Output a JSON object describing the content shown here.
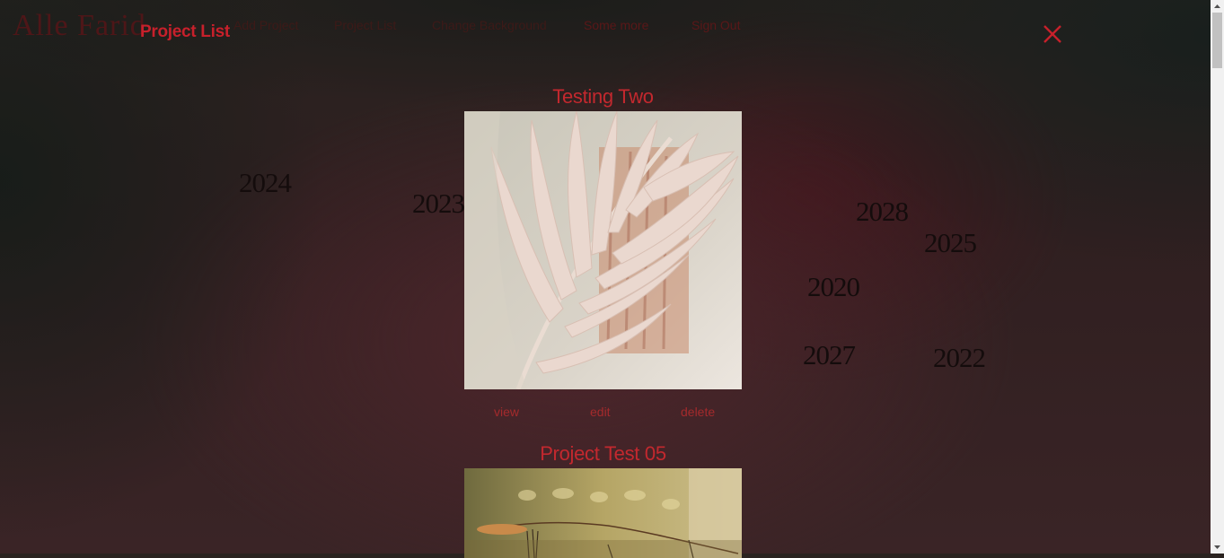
{
  "nav": {
    "logo": "Alle Farid",
    "active_label": "Project List",
    "links": [
      "Add Project",
      "Project List",
      "Change Background",
      "Some more",
      "Sign Out"
    ]
  },
  "years": [
    "2024",
    "2023",
    "2028",
    "2025",
    "2020",
    "2027",
    "2022"
  ],
  "projects": [
    {
      "title": "Testing Two",
      "actions": {
        "view": "view",
        "edit": "edit",
        "delete": "delete"
      }
    },
    {
      "title": "Project Test 05"
    }
  ],
  "colors": {
    "accent": "#c7202b",
    "card_title": "#c3282e",
    "action": "#a42a2c"
  }
}
